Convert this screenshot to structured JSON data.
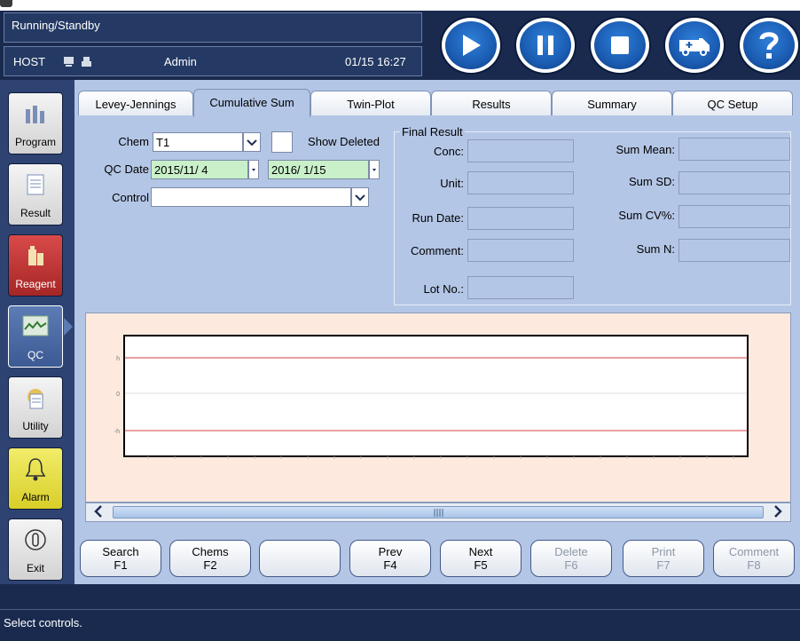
{
  "header": {
    "status": "Running/Standby",
    "host": "HOST",
    "user": "Admin",
    "datetime": "01/15 16:27"
  },
  "nav": [
    {
      "label": "Program"
    },
    {
      "label": "Result"
    },
    {
      "label": "Reagent"
    },
    {
      "label": "QC"
    },
    {
      "label": "Utility"
    },
    {
      "label": "Alarm"
    },
    {
      "label": "Exit"
    }
  ],
  "tabs": [
    "Levey-Jennings",
    "Cumulative Sum",
    "Twin-Plot",
    "Results",
    "Summary",
    "QC Setup"
  ],
  "active_tab": "Cumulative Sum",
  "filters": {
    "chem_label": "Chem",
    "chem_value": "T1",
    "show_deleted_label": "Show Deleted",
    "qc_date_label": "QC Date",
    "date_from": "2015/11/ 4",
    "date_to": "2016/ 1/15",
    "control_label": "Control",
    "control_value": ""
  },
  "final_result": {
    "legend": "Final Result",
    "conc": "Conc:",
    "unit": "Unit:",
    "run_date": "Run Date:",
    "comment": "Comment:",
    "lot_no": "Lot No.:",
    "sum_mean": "Sum Mean:",
    "sum_sd": "Sum SD:",
    "sum_cv": "Sum CV%:",
    "sum_n": "Sum N:"
  },
  "chart": {
    "y_labels": [
      "h",
      "0",
      "-h"
    ],
    "limit_color": "#d94040"
  },
  "fkeys": [
    {
      "label": "Search",
      "key": "F1",
      "enabled": true
    },
    {
      "label": "Chems",
      "key": "F2",
      "enabled": true
    },
    {
      "label": "",
      "key": "",
      "enabled": true
    },
    {
      "label": "Prev",
      "key": "F4",
      "enabled": true
    },
    {
      "label": "Next",
      "key": "F5",
      "enabled": true
    },
    {
      "label": "Delete",
      "key": "F6",
      "enabled": false
    },
    {
      "label": "Print",
      "key": "F7",
      "enabled": false
    },
    {
      "label": "Comment",
      "key": "F8",
      "enabled": false
    }
  ],
  "status_message": "Select controls."
}
